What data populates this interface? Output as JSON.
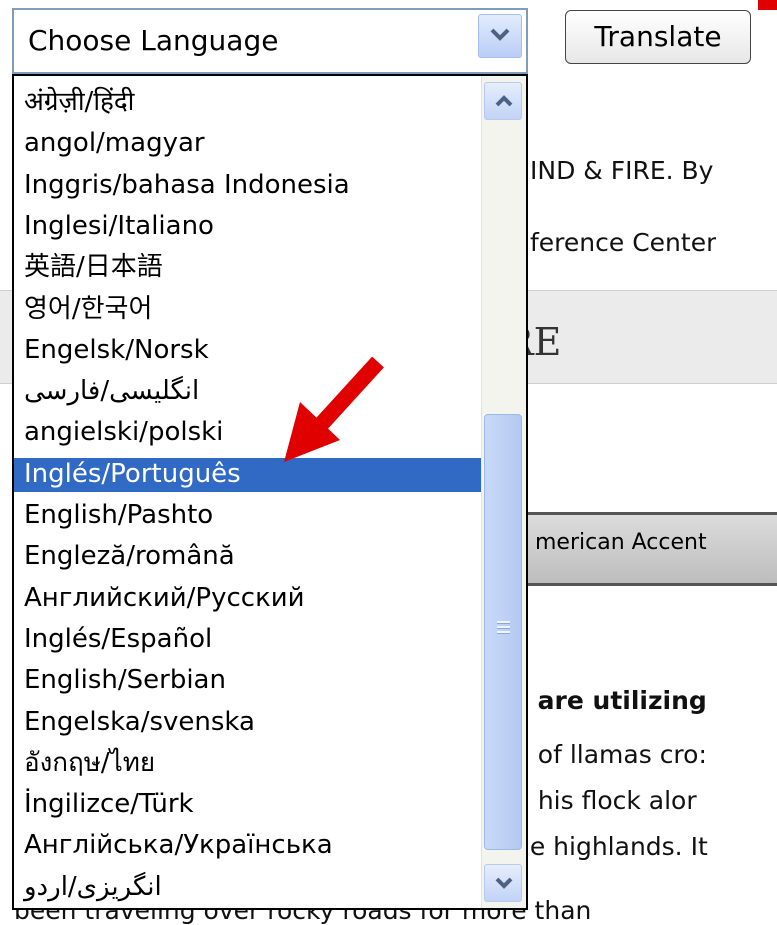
{
  "language_select": {
    "current_value": "Choose Language",
    "options": [
      "अंग्रेज़ी/हिंदी",
      "angol/magyar",
      "Inggris/bahasa Indonesia",
      "Inglesi/Italiano",
      "英語/日本語",
      "영어/한국어",
      "Engelsk/Norsk",
      "انگلیسی/فارسی",
      "angielski/polski",
      "Inglés/Português",
      "English/Pashto",
      "Engleză/română",
      "Английский/Русский",
      "Inglés/Español",
      "English/Serbian",
      "Engelska/svenska",
      "อังกฤษ/ไทย",
      "İngilizce/Türk",
      "Англійська/Українська",
      "انگریزی/اردو"
    ],
    "highlighted_option": "Inglés/Português"
  },
  "toolbar": {
    "translate_label": "Translate"
  },
  "background_page": {
    "line1": "IND & FIRE. By",
    "line2": "ference Center",
    "heading_fragment": "RE",
    "accent_label": "merican Accent",
    "bold_fragment": "e are utilizing",
    "body_lines": [
      "n of llamas cro:",
      "g his flock alor",
      "he highlands. It",
      "been traveling over rocky roads for more than"
    ]
  },
  "icons": {
    "dropdown_arrow": "chevron-down-icon",
    "scroll_up": "chevron-up-icon",
    "scroll_down": "chevron-down-icon",
    "annotation": "red-arrow-icon"
  },
  "colors": {
    "selection": "#316ac5",
    "annotation": "#e00000",
    "select_border": "#7f9db9"
  }
}
